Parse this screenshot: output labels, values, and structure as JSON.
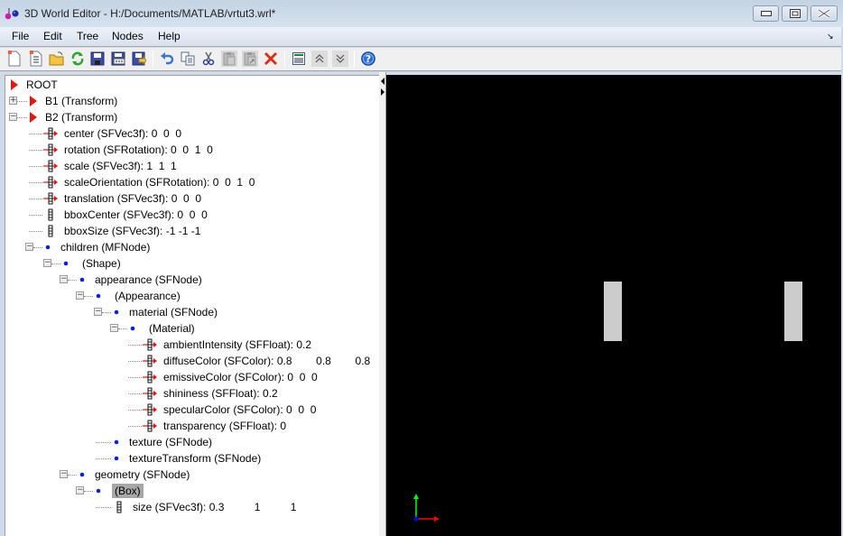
{
  "window": {
    "title": "3D World Editor - H:/Documents/MATLAB/vrtut3.wrl*",
    "controls": [
      "minimize",
      "maximize",
      "close"
    ]
  },
  "menu": {
    "items": [
      "File",
      "Edit",
      "Tree",
      "Nodes",
      "Help"
    ]
  },
  "toolbar": {
    "buttons": [
      {
        "name": "new-world-icon",
        "tooltip": "New"
      },
      {
        "name": "new-from-template-icon",
        "tooltip": "New from template"
      },
      {
        "name": "open-icon",
        "tooltip": "Open"
      },
      {
        "name": "reload-icon",
        "tooltip": "Reload"
      },
      {
        "name": "save-icon",
        "tooltip": "Save"
      },
      {
        "name": "save-as-icon",
        "tooltip": "Save As"
      },
      {
        "name": "export-icon",
        "tooltip": "Export"
      },
      {
        "name": "undo-icon",
        "tooltip": "Undo"
      },
      {
        "name": "copy-icon",
        "tooltip": "Copy"
      },
      {
        "name": "cut-icon",
        "tooltip": "Cut"
      },
      {
        "name": "paste-icon",
        "tooltip": "Paste"
      },
      {
        "name": "paste-special-icon",
        "tooltip": "Paste Special"
      },
      {
        "name": "delete-icon",
        "tooltip": "Delete"
      },
      {
        "name": "edit-field-icon",
        "tooltip": "Edit"
      },
      {
        "name": "move-up-icon",
        "tooltip": "Move Up"
      },
      {
        "name": "move-down-icon",
        "tooltip": "Move Down"
      },
      {
        "name": "help-icon",
        "tooltip": "Help"
      }
    ]
  },
  "tree": {
    "nodes": [
      {
        "label": "ROOT",
        "icon": "node",
        "selected": false
      },
      {
        "label": "B1 (Transform)",
        "icon": "node",
        "expanded": false
      },
      {
        "label": "B2 (Transform)",
        "icon": "node",
        "expanded": true
      },
      {
        "label": "center (SFVec3f): 0  0  0",
        "icon": "exposed-field"
      },
      {
        "label": "rotation (SFRotation): 0  0  1  0",
        "icon": "exposed-field"
      },
      {
        "label": "scale (SFVec3f): 1  1  1",
        "icon": "exposed-field"
      },
      {
        "label": "scaleOrientation (SFRotation): 0  0  1  0",
        "icon": "exposed-field"
      },
      {
        "label": "translation (SFVec3f): 0  0  0",
        "icon": "exposed-field"
      },
      {
        "label": "bboxCenter (SFVec3f): 0  0  0",
        "icon": "field"
      },
      {
        "label": "bboxSize (SFVec3f): -1 -1 -1",
        "icon": "field"
      },
      {
        "label": "children (MFNode)",
        "icon": "dot",
        "expanded": true
      },
      {
        "label": "(Shape)",
        "icon": "dot",
        "expanded": true
      },
      {
        "label": "appearance (SFNode)",
        "icon": "dot",
        "expanded": true
      },
      {
        "label": "(Appearance)",
        "icon": "dot",
        "expanded": true
      },
      {
        "label": "material (SFNode)",
        "icon": "dot",
        "expanded": true
      },
      {
        "label": "(Material)",
        "icon": "dot",
        "expanded": true
      },
      {
        "label": "ambientIntensity (SFFloat): 0.2",
        "icon": "exposed-field"
      },
      {
        "label": "diffuseColor (SFColor): 0.8        0.8        0.8",
        "icon": "exposed-field"
      },
      {
        "label": "emissiveColor (SFColor): 0  0  0",
        "icon": "exposed-field"
      },
      {
        "label": "shininess (SFFloat): 0.2",
        "icon": "exposed-field"
      },
      {
        "label": "specularColor (SFColor): 0  0  0",
        "icon": "exposed-field"
      },
      {
        "label": "transparency (SFFloat): 0",
        "icon": "exposed-field"
      },
      {
        "label": "texture (SFNode)",
        "icon": "dot"
      },
      {
        "label": "textureTransform (SFNode)",
        "icon": "dot"
      },
      {
        "label": "geometry (SFNode)",
        "icon": "dot",
        "expanded": true
      },
      {
        "label": "(Box)",
        "icon": "dot",
        "expanded": true,
        "selected": true
      },
      {
        "label": "size (SFVec3f): 0.3          1          1",
        "icon": "field"
      }
    ]
  },
  "viewport": {
    "background": "#000000",
    "object_color": "#cccccc",
    "axes": {
      "x": "#ff0000",
      "y": "#00ff00",
      "z": "#0000ff"
    }
  }
}
